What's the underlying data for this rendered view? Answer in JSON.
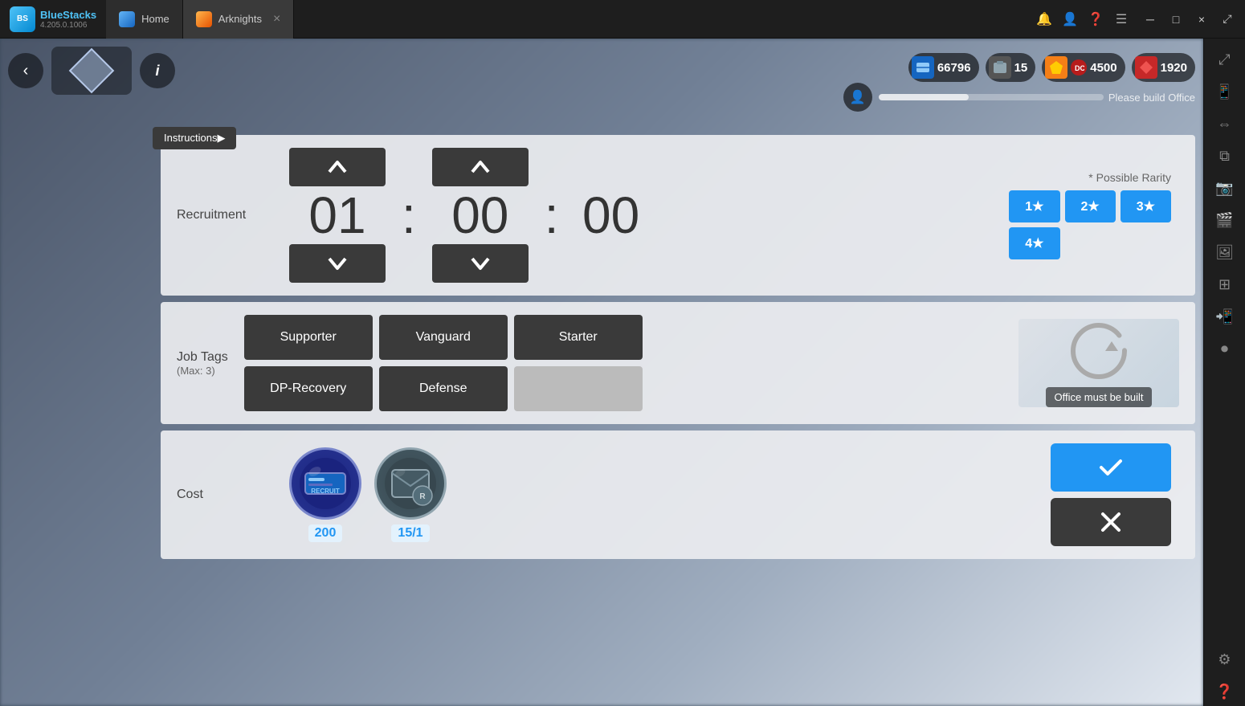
{
  "app": {
    "title": "BlueStacks",
    "version": "4.205.0.1006",
    "tabs": [
      {
        "label": "Home",
        "active": false
      },
      {
        "label": "Arknights",
        "active": true
      }
    ]
  },
  "topbar_icons": [
    "bell",
    "user",
    "question",
    "menu"
  ],
  "window_controls": [
    "minimize",
    "maximize",
    "close",
    "expand"
  ],
  "sidebar_icons": [
    "expand",
    "phone",
    "resize",
    "layers",
    "camera",
    "film",
    "image",
    "grid",
    "mobile",
    "record",
    "gear",
    "help"
  ],
  "game": {
    "currency": [
      {
        "icon": "ticket",
        "value": "66796",
        "color": "blue"
      },
      {
        "icon": "photo",
        "value": "15",
        "color": "gray"
      },
      {
        "icon": "gem",
        "value": "4500",
        "color": "gold"
      },
      {
        "icon": "diamond",
        "value": "1920",
        "color": "red"
      }
    ],
    "please_build_text": "Please build Office",
    "back_label": "◀",
    "info_label": "i",
    "instructions_label": "Instructions▶"
  },
  "recruitment": {
    "label": "Recruitment",
    "time_hours": "01",
    "time_minutes": "00",
    "time_seconds": "00",
    "rarity_title": "* Possible Rarity",
    "rarity_options": [
      {
        "value": "1★",
        "active": true
      },
      {
        "value": "2★",
        "active": true
      },
      {
        "value": "3★",
        "active": true
      },
      {
        "value": "4★",
        "active": true
      }
    ]
  },
  "job_tags": {
    "label": "Job Tags",
    "sublabel": "(Max: 3)",
    "tags": [
      {
        "label": "Supporter",
        "active": true
      },
      {
        "label": "Vanguard",
        "active": true
      },
      {
        "label": "Starter",
        "active": true
      },
      {
        "label": "DP-Recovery",
        "active": true
      },
      {
        "label": "Defense",
        "active": true
      },
      {
        "label": "",
        "active": false
      }
    ],
    "office_notice": "Office must be built"
  },
  "cost": {
    "label": "Cost",
    "items": [
      {
        "value": "200",
        "type": "blue_ticket"
      },
      {
        "value": "15/1",
        "type": "gray_ticket"
      }
    ]
  },
  "actions": {
    "confirm_label": "✓",
    "cancel_label": "✕"
  }
}
